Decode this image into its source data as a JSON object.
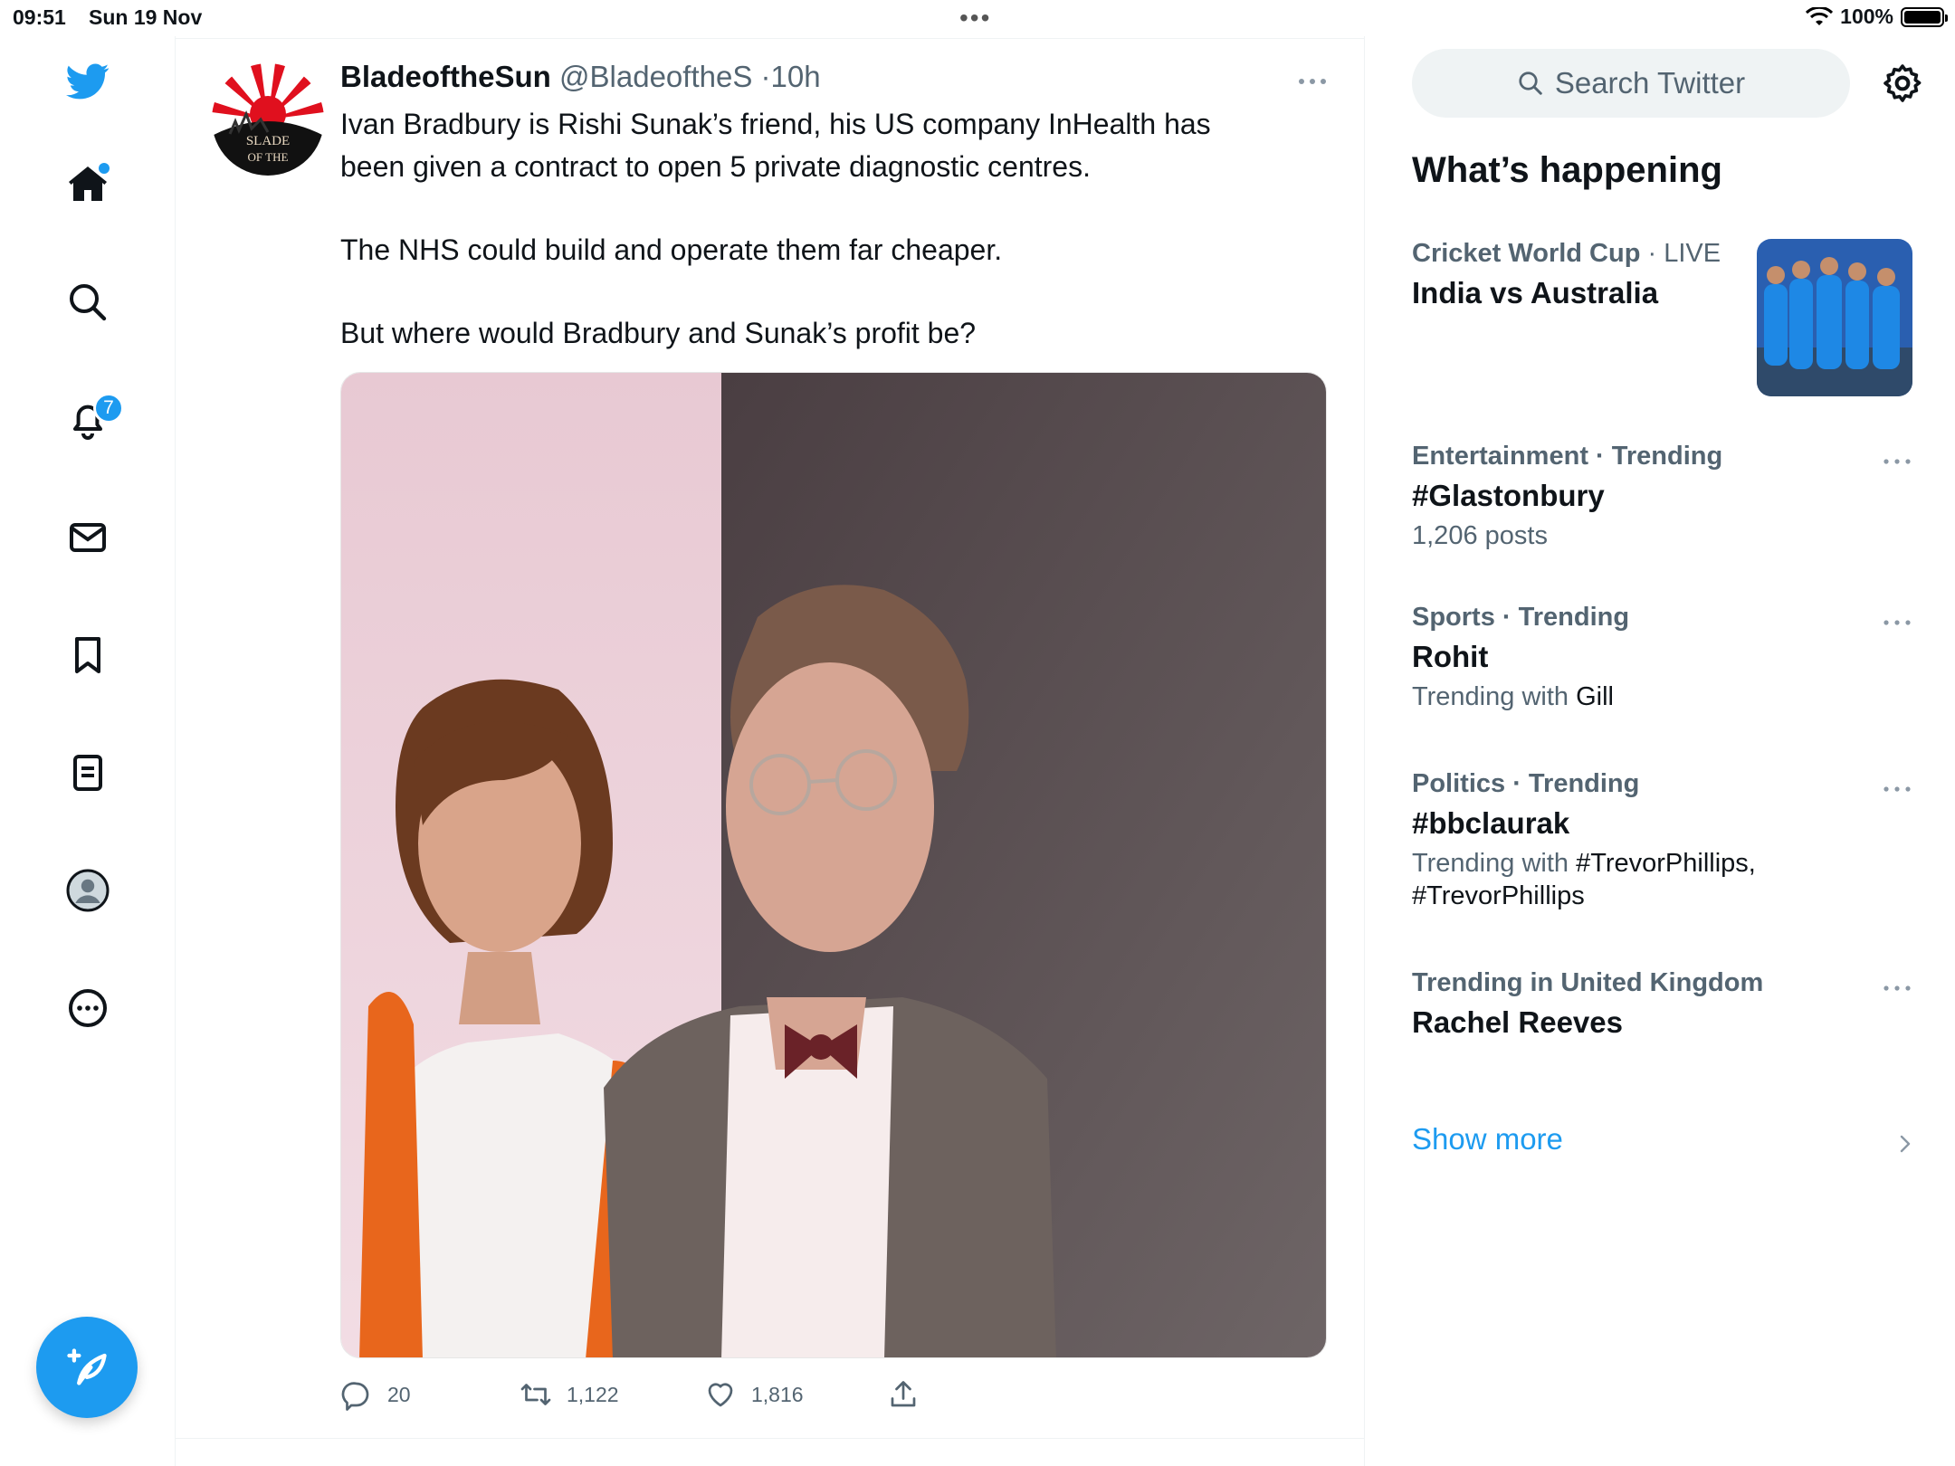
{
  "status_bar": {
    "time": "09:51",
    "date": "Sun 19 Nov",
    "battery": "100%"
  },
  "nav": {
    "notifications_badge": "7",
    "icons": [
      "twitter-logo-icon",
      "home-icon",
      "search-icon",
      "bell-icon",
      "mail-icon",
      "bookmark-icon",
      "lists-icon",
      "profile-avatar",
      "more-icon",
      "compose-icon"
    ]
  },
  "tweet": {
    "display_name": "BladeoftheSun",
    "handle": "@BladeoftheS",
    "separator": "·",
    "age": "10h",
    "avatar_text": [
      "SLADE",
      "OF THE"
    ],
    "text_lines": [
      "Ivan Bradbury is Rishi Sunak’s friend, his US company InHealth has",
      "been given a contract to open 5 private diagnostic centres.",
      "The NHS could build and operate them far cheaper.",
      "But where would Bradbury and Sunak’s profit be?"
    ],
    "replies": "20",
    "retweets": "1,122",
    "likes": "1,816"
  },
  "sidebar": {
    "search_placeholder": "Search Twitter",
    "heading": "What’s happening",
    "trends": [
      {
        "category": "Cricket World Cup",
        "tag": "LIVE",
        "title": "India vs Australia",
        "sub": ""
      },
      {
        "category": "Entertainment · Trending",
        "title": "#Glastonbury",
        "sub": "1,206 posts"
      },
      {
        "category": "Sports · Trending",
        "title": "Rohit",
        "sub_prefix": "Trending with ",
        "sub_dark": "Gill"
      },
      {
        "category": "Politics · Trending",
        "title": "#bbclaurak",
        "sub_prefix": "Trending with ",
        "sub_dark": "#TrevorPhillips,",
        "sub_line2": "#TrevorPhillips"
      },
      {
        "category": "Trending in United Kingdom",
        "title": "Rachel Reeves",
        "sub": ""
      }
    ],
    "show_more": "Show more"
  },
  "colors": {
    "accent": "#1d9bf0",
    "text": "#0f1419",
    "muted": "#536471"
  }
}
